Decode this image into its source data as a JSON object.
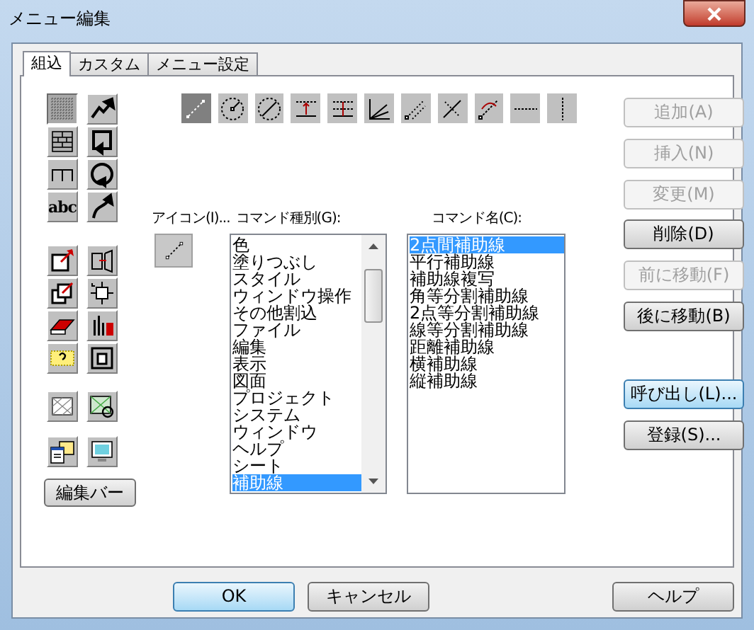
{
  "window": {
    "title": "メニュー編集"
  },
  "tabs": [
    {
      "label": "組込",
      "selected": true
    },
    {
      "label": "カスタム",
      "selected": false
    },
    {
      "label": "メニュー設定",
      "selected": false
    }
  ],
  "palette": [
    {
      "selected": true
    },
    {
      "selected": false
    },
    {
      "selected": false
    },
    {
      "selected": false
    },
    {
      "selected": false
    },
    {
      "selected": false
    },
    {
      "selected": false,
      "label": "abc"
    },
    {
      "selected": false
    },
    {
      "selected": false
    },
    {
      "selected": false
    },
    {
      "selected": false
    },
    {
      "selected": false
    },
    {
      "selected": false
    },
    {
      "selected": false
    },
    {
      "selected": false
    },
    {
      "selected": false
    },
    {
      "selected": false
    },
    {
      "selected": false
    },
    {
      "selected": false
    },
    {
      "selected": false
    }
  ],
  "guide_tools": [
    {
      "selected": true
    },
    {
      "selected": false
    },
    {
      "selected": false
    },
    {
      "selected": false
    },
    {
      "selected": false
    },
    {
      "selected": false
    },
    {
      "selected": false
    },
    {
      "selected": false
    },
    {
      "selected": false
    },
    {
      "selected": false
    },
    {
      "selected": false
    }
  ],
  "icon_label": "アイコン(I)...",
  "command_types": {
    "label": "コマンド種別(G):",
    "items": [
      {
        "label": "色",
        "selected": false
      },
      {
        "label": "塗りつぶし",
        "selected": false
      },
      {
        "label": "スタイル",
        "selected": false
      },
      {
        "label": "ウィンドウ操作",
        "selected": false
      },
      {
        "label": "その他割込",
        "selected": false
      },
      {
        "label": "ファイル",
        "selected": false
      },
      {
        "label": "編集",
        "selected": false
      },
      {
        "label": "表示",
        "selected": false
      },
      {
        "label": "図面",
        "selected": false
      },
      {
        "label": "プロジェクト",
        "selected": false
      },
      {
        "label": "システム",
        "selected": false
      },
      {
        "label": "ウィンドウ",
        "selected": false
      },
      {
        "label": "ヘルプ",
        "selected": false
      },
      {
        "label": "シート",
        "selected": false
      },
      {
        "label": "補助線",
        "selected": true
      }
    ]
  },
  "command_names": {
    "label": "コマンド名(C):",
    "items": [
      {
        "label": "2点間補助線",
        "selected": true
      },
      {
        "label": "平行補助線",
        "selected": false
      },
      {
        "label": "補助線複写",
        "selected": false
      },
      {
        "label": "角等分割補助線",
        "selected": false
      },
      {
        "label": "2点等分割補助線",
        "selected": false
      },
      {
        "label": "線等分割補助線",
        "selected": false
      },
      {
        "label": "距離補助線",
        "selected": false
      },
      {
        "label": "横補助線",
        "selected": false
      },
      {
        "label": "縦補助線",
        "selected": false
      }
    ]
  },
  "side_buttons": [
    {
      "label": "追加(A)",
      "disabled": true
    },
    {
      "label": "挿入(N)",
      "disabled": true
    },
    {
      "label": "変更(M)",
      "disabled": true
    },
    {
      "label": "削除(D)",
      "disabled": false
    },
    {
      "label": "前に移動(F)",
      "disabled": true
    },
    {
      "label": "後に移動(B)",
      "disabled": false
    },
    {
      "label": "呼び出し(L)...",
      "disabled": false,
      "focused": true
    },
    {
      "label": "登録(S)...",
      "disabled": false,
      "focused": false
    }
  ],
  "edit_bar_button": "編集バー",
  "dialog_buttons": [
    {
      "label": "OK",
      "default": true
    },
    {
      "label": "キャンセル",
      "default": false
    },
    {
      "label": "ヘルプ",
      "default": false
    }
  ]
}
